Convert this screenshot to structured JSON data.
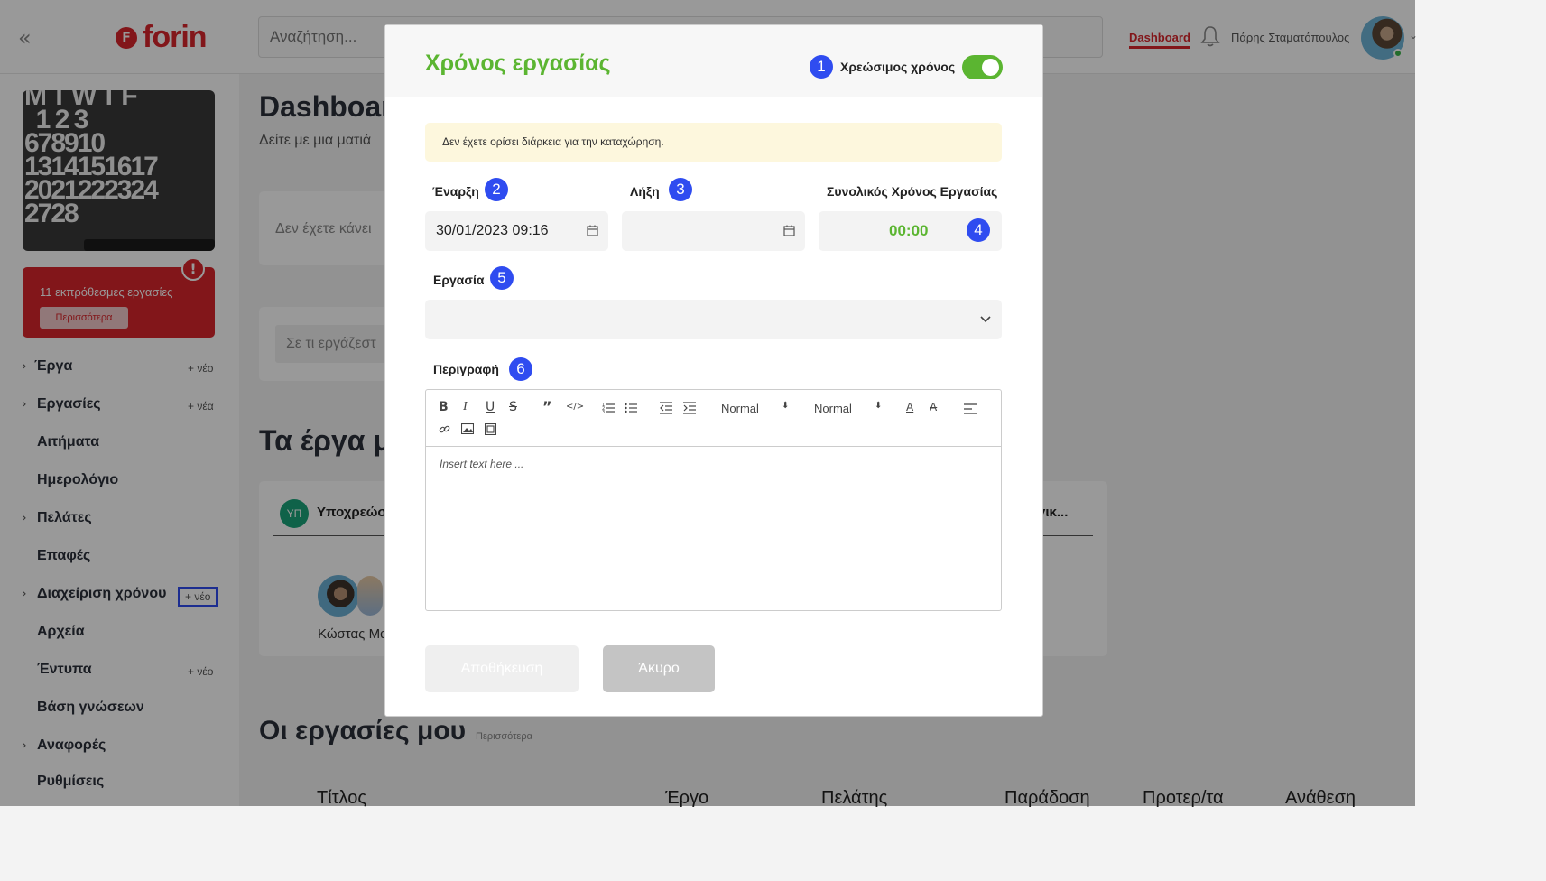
{
  "app": {
    "brand": "forin",
    "brand_mark": "F"
  },
  "topbar": {
    "search_placeholder": "Αναζήτηση...",
    "nav_dashboard": "Dashboard",
    "user_name": "Πάρης Σταματόπουλος",
    "icons": {
      "collapse": "double-chevron-left-icon",
      "bell": "bell-icon"
    }
  },
  "sidebar": {
    "calendar_days": [
      "M",
      "T",
      "W",
      "T",
      "F",
      "1",
      "2",
      "3",
      "6",
      "7",
      "8",
      "9",
      "10",
      "13",
      "14",
      "15",
      "16",
      "17",
      "20",
      "21",
      "22",
      "23",
      "24",
      "27",
      "28"
    ],
    "alert": {
      "text": "11 εκπρόθεσμες εργασίες",
      "button": "Περισσότερα",
      "icon": "!"
    },
    "items": [
      {
        "label": "Έργα",
        "chevron": true,
        "new": "+ νέο"
      },
      {
        "label": "Εργασίες",
        "chevron": true,
        "new": "+ νέα"
      },
      {
        "label": "Αιτήματα",
        "chevron": false,
        "new": ""
      },
      {
        "label": "Ημερολόγιο",
        "chevron": false,
        "new": ""
      },
      {
        "label": "Πελάτες",
        "chevron": true,
        "new": ""
      },
      {
        "label": "Επαφές",
        "chevron": false,
        "new": ""
      },
      {
        "label": "Διαχείριση χρόνου",
        "chevron": true,
        "new": "+ νέο",
        "highlighted": true
      },
      {
        "label": "Αρχεία",
        "chevron": false,
        "new": ""
      },
      {
        "label": "Έντυπα",
        "chevron": false,
        "new": "+ νέο"
      },
      {
        "label": "Βάση γνώσεων",
        "chevron": false,
        "new": ""
      },
      {
        "label": "Αναφορές",
        "chevron": true,
        "new": ""
      },
      {
        "label": "Ρυθμίσεις",
        "chevron": false,
        "new": ""
      }
    ]
  },
  "main": {
    "title": "Dashboar",
    "subtitle": "Δείτε με μια ματιά",
    "card1_text": "Δεν έχετε κάνει",
    "card2_placeholder": "Σε τι εργάζεστ",
    "projects_title": "Τα έργα μ",
    "project": {
      "badge": "ΥΠ",
      "name": "Υποχρεώσ",
      "other": "γικ...",
      "person": "Κώστας Μα"
    },
    "tasks_title": "Οι εργασίες μου",
    "tasks_more": "Περισσότερα",
    "table_headers": [
      "Τίτλος",
      "Έργο",
      "Πελάτης",
      "Παράδοση",
      "Προτερ/τα",
      "Ανάθεση"
    ]
  },
  "modal": {
    "title": "Χρόνος εργασίας",
    "billable_label": "Χρεώσιμος χρόνος",
    "billable_on": true,
    "warning": "Δεν έχετε ορίσει διάρκεια για την καταχώρηση.",
    "start_label": "Έναρξη",
    "start_value": "30/01/2023 09:16",
    "end_label": "Λήξη",
    "end_value": "",
    "total_label": "Συνολικός Χρόνος Εργασίας",
    "total_value": "00:00",
    "task_label": "Εργασία",
    "task_value": "",
    "description_label": "Περιγραφή",
    "editor": {
      "placeholder": "Insert text here ...",
      "size_select": "Normal",
      "header_select": "Normal",
      "toolbar": [
        "bold-icon",
        "italic-icon",
        "underline-icon",
        "strike-icon",
        "blockquote-icon",
        "code-icon",
        "ordered-list-icon",
        "bullet-list-icon",
        "outdent-icon",
        "indent-icon",
        "text-color-icon",
        "background-color-icon",
        "align-icon",
        "link-icon",
        "image-icon",
        "video-icon"
      ]
    },
    "save_button": "Αποθήκευση",
    "cancel_button": "Άκυρο",
    "markers": [
      "1",
      "2",
      "3",
      "4",
      "5",
      "6"
    ]
  },
  "colors": {
    "brand": "#d9262c",
    "accent_green": "#5bb531",
    "marker_blue": "#2f4cf0"
  }
}
